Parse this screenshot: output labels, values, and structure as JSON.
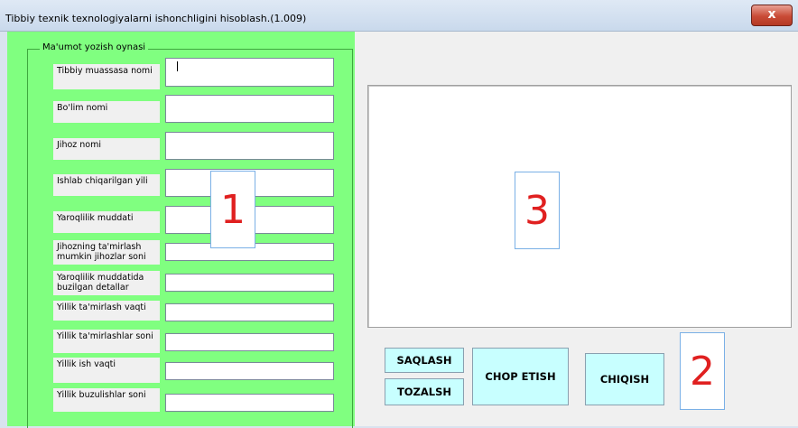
{
  "window": {
    "title": "Tibbiy texnik texnologiyalarni ishonchligini hisoblash.(1.009)",
    "close_glyph": "x"
  },
  "form": {
    "group_title": "Ma'umot yozish oynasi",
    "fields": [
      {
        "label": "Tibbiy muassasa nomi",
        "value": ""
      },
      {
        "label": "Bo'lim nomi",
        "value": ""
      },
      {
        "label": "Jihoz nomi",
        "value": ""
      },
      {
        "label": "Ishlab chiqarilgan yili",
        "value": ""
      },
      {
        "label": "Yaroqlilik muddati",
        "value": ""
      },
      {
        "label": "Jihozning ta'mirlash mumkin jihozlar soni",
        "value": ""
      },
      {
        "label": "Yaroqlilik muddatida buzilgan detallar",
        "value": ""
      },
      {
        "label": "Yillik ta'mirlash vaqti",
        "value": ""
      },
      {
        "label": "Yillik ta'mirlashlar soni",
        "value": ""
      },
      {
        "label": "Yillik ish vaqti",
        "value": ""
      },
      {
        "label": "Yillik buzulishlar soni",
        "value": ""
      }
    ]
  },
  "buttons": {
    "save": "SAQLASH",
    "clear": "TOZALSH",
    "print": "CHOP ETISH",
    "exit": "CHIQISH"
  },
  "markers": {
    "m1": "1",
    "m2": "2",
    "m3": "3"
  },
  "colors": {
    "panel": "#80ff80",
    "button": "#c8ffff",
    "marker_text": "#e02020",
    "close": "#c94b36"
  }
}
